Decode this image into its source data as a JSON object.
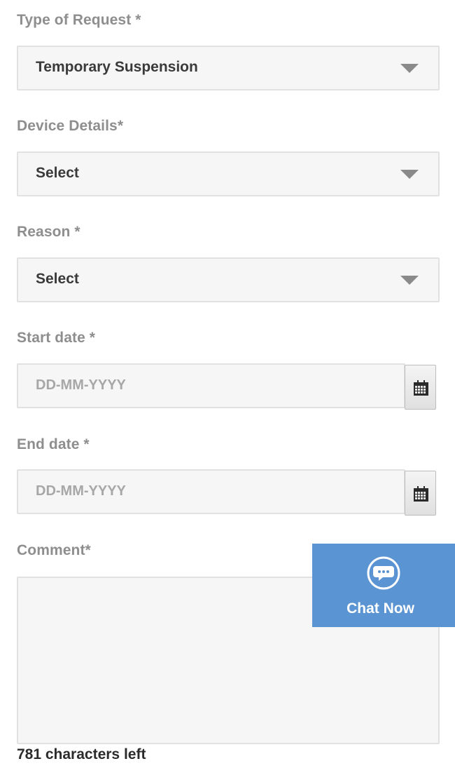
{
  "form": {
    "request_type": {
      "label": "Type of Request *",
      "value": "Temporary Suspension"
    },
    "device_details": {
      "label": "Device Details*",
      "value": "Select"
    },
    "reason": {
      "label": "Reason *",
      "value": "Select"
    },
    "start_date": {
      "label": "Start date *",
      "placeholder": "DD-MM-YYYY"
    },
    "end_date": {
      "label": "End date *",
      "placeholder": "DD-MM-YYYY"
    },
    "comment": {
      "label": "Comment*",
      "value": "",
      "chars_left": "781 characters left"
    }
  },
  "chat": {
    "label": "Chat Now",
    "icon": "chat-bubble-icon",
    "color": "#5b94d2"
  },
  "colors": {
    "label": "#8e8e8e",
    "field_bg": "#f6f6f6",
    "field_border": "#e1e1e1"
  }
}
